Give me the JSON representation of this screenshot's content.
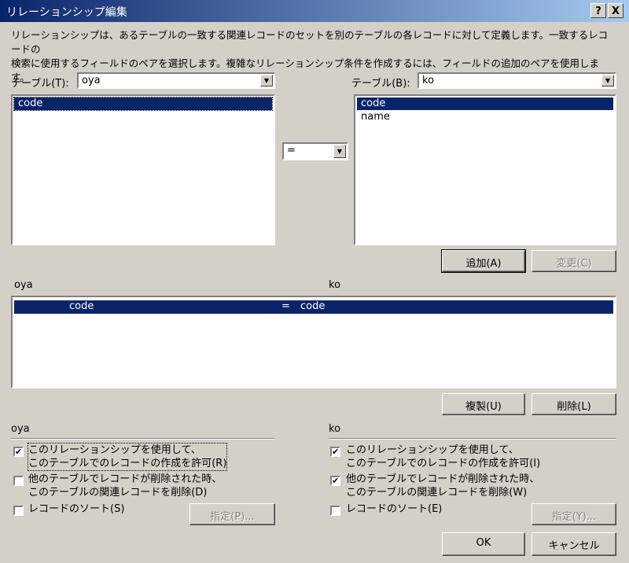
{
  "window": {
    "title": "リレーションシップ編集",
    "help_button": "?",
    "close_button": "X"
  },
  "description": {
    "line1": "リレーションシップは、あるテーブルの一致する関連レコードのセットを別のテーブルの各レコードに対して定義します。一致するレコードの",
    "line2": "検索に使用するフィールドのペアを選択します。複雑なリレーションシップ条件を作成するには、フィールドの追加のペアを使用します。"
  },
  "left_table": {
    "label": "テーブル(T):",
    "selected": "oya",
    "fields": [
      "code"
    ],
    "selected_index": 0
  },
  "operator": {
    "selected": "="
  },
  "right_table": {
    "label": "テーブル(B):",
    "selected": "ko",
    "fields": [
      "code",
      "name"
    ],
    "selected_index": 0
  },
  "buttons": {
    "add": "追加(A)",
    "change": "変更(C)",
    "duplicate": "複製(U)",
    "delete": "削除(L)",
    "left_specify": "指定(P)...",
    "right_specify": "指定(Y)...",
    "ok": "OK",
    "cancel": "キャンセル"
  },
  "pairs": {
    "left_header": "oya",
    "right_header": "ko",
    "rows": [
      {
        "left": "code",
        "op": "=",
        "right": "code"
      }
    ]
  },
  "left_options": {
    "header": "oya",
    "allow_create_line1": "このリレーションシップを使用して、",
    "allow_create_line2": "このテーブルでのレコードの作成を許可(R)",
    "allow_create_checked": true,
    "cascade_delete_line1": "他のテーブルでレコードが削除された時、",
    "cascade_delete_line2": "このテーブルの関連レコードを削除(D)",
    "cascade_delete_checked": false,
    "sort_label": "レコードのソート(S)",
    "sort_checked": false
  },
  "right_options": {
    "header": "ko",
    "allow_create_line1": "このリレーションシップを使用して、",
    "allow_create_line2": "このテーブルでのレコードの作成を許可(I)",
    "allow_create_checked": true,
    "cascade_delete_line1": "他のテーブルでレコードが削除された時、",
    "cascade_delete_line2": "このテーブルの関連レコードを削除(W)",
    "cascade_delete_checked": true,
    "sort_label": "レコードのソート(E)",
    "sort_checked": false
  },
  "icons": {
    "check": "✔",
    "dropdown": "▼"
  },
  "colors": {
    "selection": "#0a246a",
    "face": "#d4d0c8"
  }
}
